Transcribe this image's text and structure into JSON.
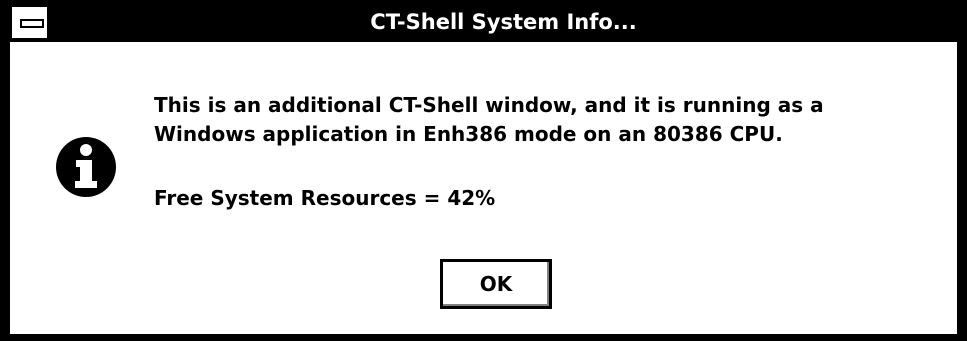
{
  "window": {
    "title": "CT-Shell System Info...",
    "system_menu_icon": "system-menu-icon"
  },
  "dialog": {
    "icon": "information-icon",
    "message_lines": [
      "This is an additional CT-Shell window, and it is running as a",
      "Windows application in Enh386 mode on an 80386 CPU."
    ],
    "resources_text": "Free System Resources = 42%",
    "ok_label": "OK"
  },
  "colors": {
    "frame": "#000000",
    "background": "#ffffff",
    "title_text": "#ffffff"
  }
}
